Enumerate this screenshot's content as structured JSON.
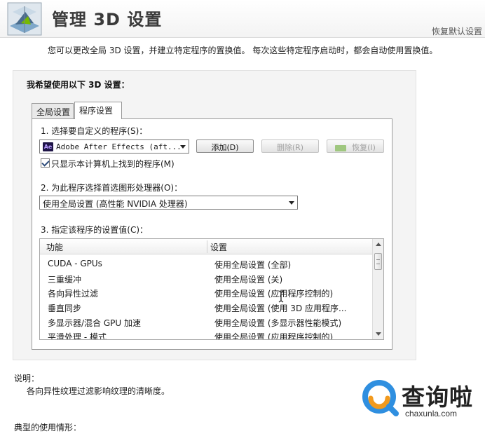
{
  "header": {
    "title": "管理 3D 设置",
    "restore_link": "恢复默认设置"
  },
  "intro_text": "您可以更改全局 3D 设置，并建立特定程序的置换值。 每次这些特定程序启动时，都会自动使用置换值。",
  "panel": {
    "title": "我希望使用以下 3D 设置：",
    "tabs": [
      {
        "label": "全局设置"
      },
      {
        "label": "程序设置"
      }
    ],
    "step1": {
      "label": "1. 选择要自定义的程序(S)：",
      "program_icon": "Ae",
      "program_value": "Adobe After Effects (aft...",
      "add_button": "添加(D)",
      "delete_button": "删除(R)",
      "restore_button": "恢复(I)",
      "checkbox_label": "只显示本计算机上找到的程序(M)"
    },
    "step2": {
      "label": "2. 为此程序选择首选图形处理器(O)：",
      "value": "使用全局设置 (高性能 NVIDIA 处理器)"
    },
    "step3": {
      "label": "3. 指定该程序的设置值(C)：",
      "columns": [
        "功能",
        "设置"
      ],
      "rows": [
        {
          "feature": "CUDA - GPUs",
          "setting": "使用全局设置 (全部)"
        },
        {
          "feature": "三重缓冲",
          "setting": "使用全局设置 (关)"
        },
        {
          "feature": "各向异性过滤",
          "setting": "使用全局设置 (应用程序控制的)"
        },
        {
          "feature": "垂直同步",
          "setting": "使用全局设置 (使用 3D 应用程序..."
        },
        {
          "feature": "多显示器/混合 GPU 加速",
          "setting": "使用全局设置 (多显示器性能模式)"
        },
        {
          "feature": "平滑处理 - 模式",
          "setting": "使用全局设置 (应用程序控制的)"
        }
      ]
    }
  },
  "description": {
    "title": "说明：",
    "text": "各向异性纹理过滤影响纹理的清晰度。"
  },
  "usage": {
    "title": "典型的使用情形："
  },
  "watermark": {
    "text": "查询啦",
    "url": "chaxunla.com",
    "accent": "#f29a1e",
    "blue": "#2f8fe0"
  },
  "colors": {
    "nvidia_green": "#76b900"
  }
}
